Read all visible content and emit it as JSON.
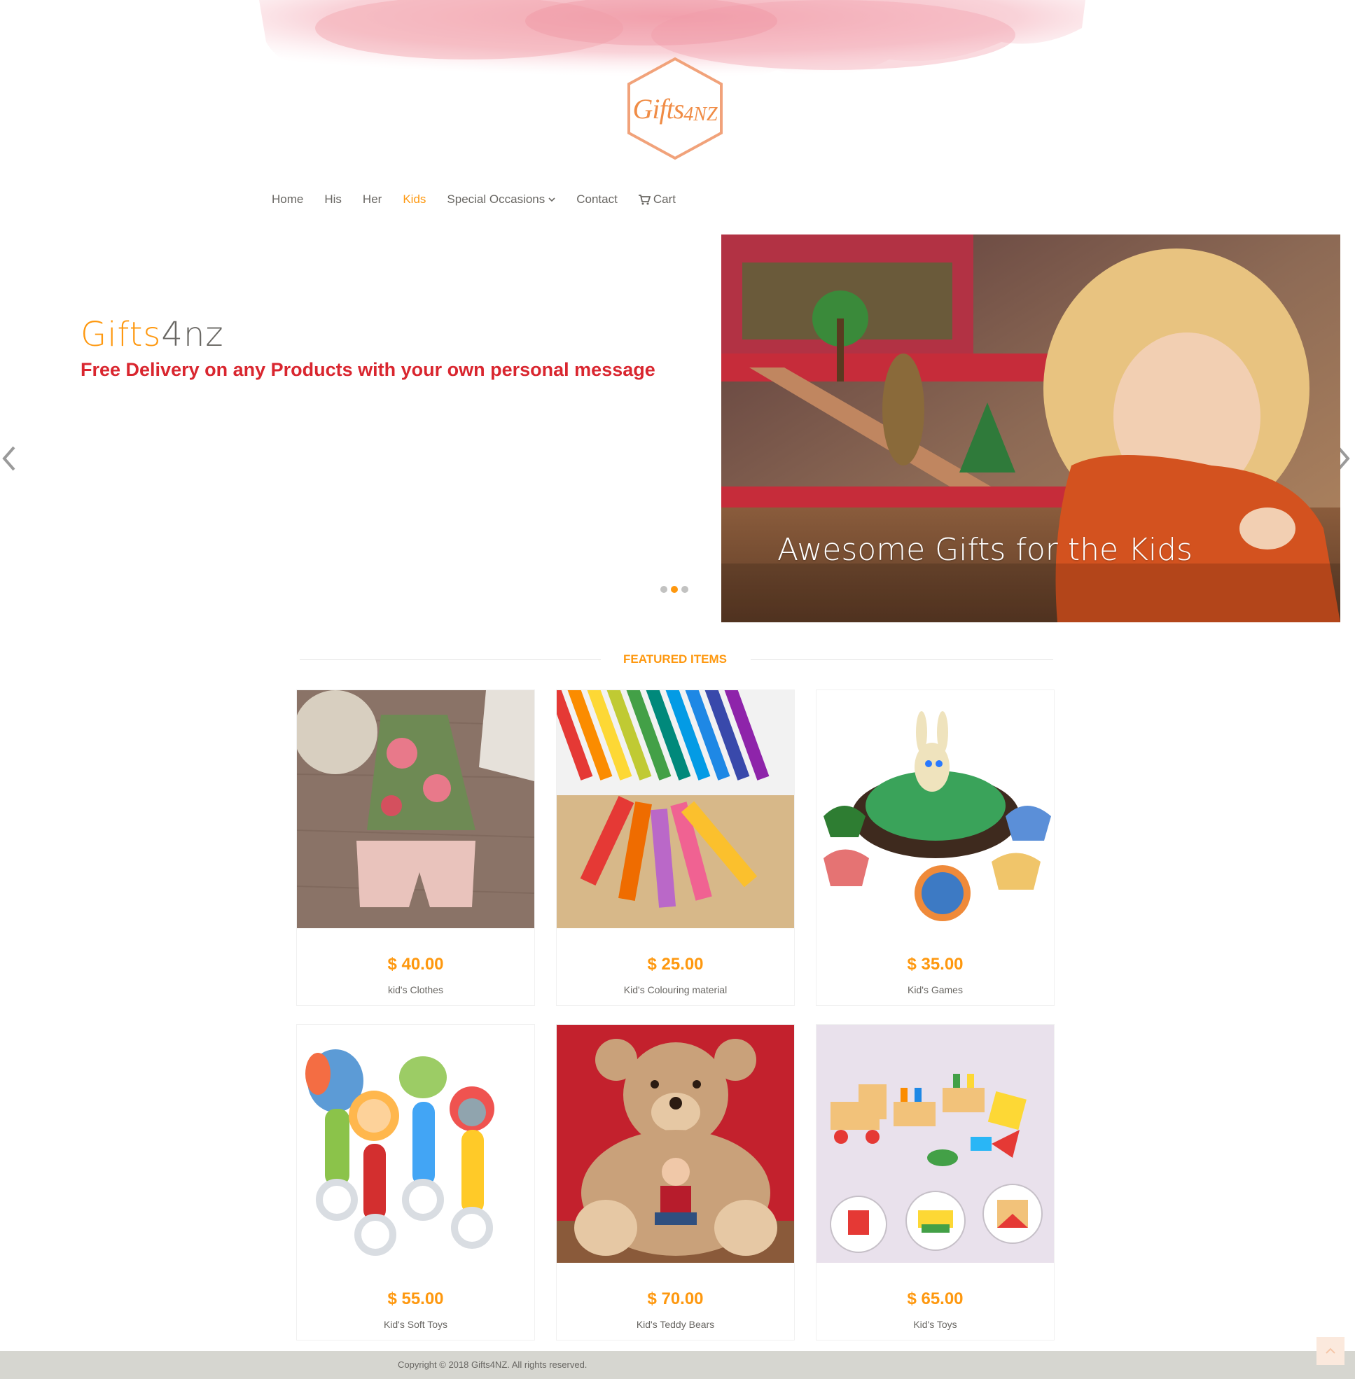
{
  "header": {
    "logo_text": "Gifts",
    "logo_sub": "4NZ"
  },
  "nav": {
    "items": [
      {
        "label": "Home"
      },
      {
        "label": "His"
      },
      {
        "label": "Her"
      },
      {
        "label": "Kids",
        "active": true
      },
      {
        "label": "Special Occasions",
        "dropdown": true
      },
      {
        "label": "Contact"
      },
      {
        "label": "Cart",
        "icon": "cart-icon"
      }
    ]
  },
  "slider": {
    "brand_part1": "Gifts",
    "brand_part2": "4nz",
    "tagline": "Free Delivery on any Products with your own personal message",
    "caption": "Awesome Gifts for the Kids",
    "active_dot": 2,
    "dot_count": 3
  },
  "featured": {
    "title": "FEATURED ITEMS",
    "products": [
      {
        "price": "$ 40.00",
        "name": "kid's Clothes"
      },
      {
        "price": "$ 25.00",
        "name": "Kid's Colouring material"
      },
      {
        "price": "$ 35.00",
        "name": "Kid's Games"
      },
      {
        "price": "$ 55.00",
        "name": "Kid's Soft Toys"
      },
      {
        "price": "$ 70.00",
        "name": "Kid's Teddy Bears"
      },
      {
        "price": "$ 65.00",
        "name": "Kid's Toys"
      }
    ]
  },
  "footer": {
    "copyright": "Copyright © 2018 Gifts4NZ. All rights reserved."
  },
  "colors": {
    "accent": "#fe980f",
    "tagline": "#d9262f",
    "text": "#696763",
    "footer_bg": "#d6d6d0"
  }
}
